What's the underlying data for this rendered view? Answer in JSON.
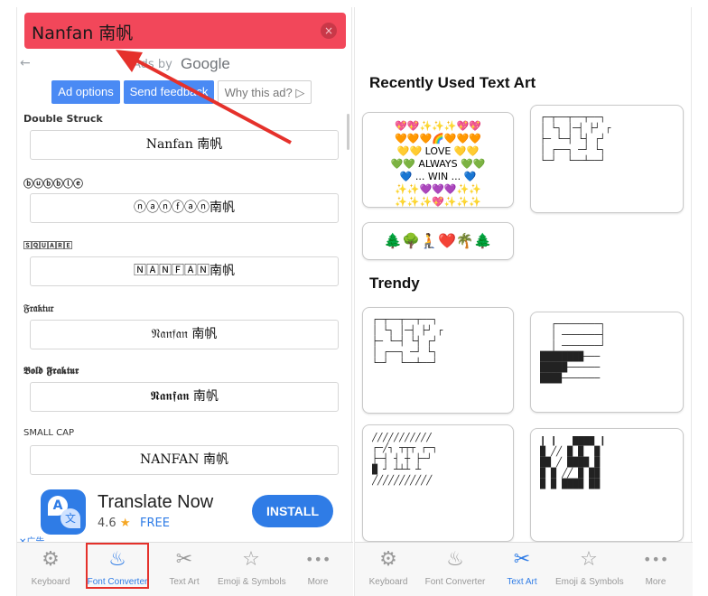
{
  "left": {
    "input_value": "Nanfan 南帆",
    "clear_icon": "×",
    "ad": {
      "back_icon": "←",
      "ads_by": "Ads by",
      "google": "Google",
      "ad_options": "Ad options",
      "send_feedback": "Send feedback",
      "why_this_ad": "Why this ad? ▷"
    },
    "fonts": [
      {
        "label": "Double Struck",
        "value": "Nanfan 南帆"
      },
      {
        "label": "ⓑⓤⓑⓑⓛⓔ",
        "value": "ⓝⓐⓝⓕⓐⓝ南帆"
      },
      {
        "label": "🅂🅀🅄🄰🅁🄴",
        "value": "🄽🄰🄽🄵🄰🄽南帆"
      },
      {
        "label": "𝔉𝔯𝔞𝔨𝔱𝔲𝔯",
        "value": "𝔑𝔞𝔫𝔣𝔞𝔫 南帆"
      },
      {
        "label": "𝕭𝖔𝖑𝖉 𝕱𝖗𝖆𝖐𝖙𝖚𝖗",
        "value": "𝕹𝖆𝖓𝖋𝖆𝖓 南帆"
      },
      {
        "label": "SMALL CAP",
        "value": "NANFAN 南帆"
      }
    ],
    "app_ad": {
      "name": "Translate Now",
      "rating": "4.6",
      "star": "★",
      "price": "FREE",
      "install": "INSTALL",
      "ad_mark": "✕广告"
    }
  },
  "tabs": [
    {
      "label": "Keyboard",
      "icon": "⚙"
    },
    {
      "label": "Font Converter",
      "icon": "♨"
    },
    {
      "label": "Text Art",
      "icon": "✂"
    },
    {
      "label": "Emoji & Symbols",
      "icon": "☆"
    },
    {
      "label": "More",
      "icon": "•••"
    }
  ],
  "right": {
    "recent_title": "Recently Used Text Art",
    "trendy_title": "Trendy",
    "emoji_card": {
      "row1": "💖💖✨✨✨💖💖",
      "row2": "🧡🧡🧡🌈🧡🧡🧡",
      "row3": "💛💛 LOVE 💛💛",
      "row4": "💚💚 ALWAYS 💚💚",
      "row5": "💙 ... WIN ... 💙",
      "row6": "✨✨💜💜💜✨✨",
      "row7": "✨✨✨💖✨✨✨"
    },
    "plant_card": "🌲🌳🧎❤️🌴🌲",
    "ascii_1": "┌─┬──┬──┬──┐\n│ └┐ │─┤ ├┘ ┌\n├─ └─┤ └┤ ┌┘\n│ ┌──┐ ─┘ └┐\n└─┘  └──┴──┘",
    "ascii_2": "┌─┬──┬──┬──┐\n│ └┐ │─┤ ├┘ ┌\n├─ └─┤ └┤ ┌┘\n│ ┌──┐ ─┘ └┐\n└─┘  └──┴──┘",
    "ascii_3": "  ┌────────┐\n  │ ───────┤\n  │ ───────┘\n████████───\n█████──────\n████───────",
    "ascii_4": "╱╱╱╱╱╱╱╱╱╱╱\n┌─╱┐ ┬┬┬ ┌─┐\n├─┤ ┤ ┼ ├─┘\n█ ┘ ┴┴┴ ┴  \n╱╱╱╱╱╱╱╱╱╱╱",
    "ascii_5": "┃ ┃   ████ ┃\n█ ╱╱ █ █  █\n██ ╱ ████ █\n█ █ ╱╱ █ ██\n█ █ ████ ██"
  }
}
